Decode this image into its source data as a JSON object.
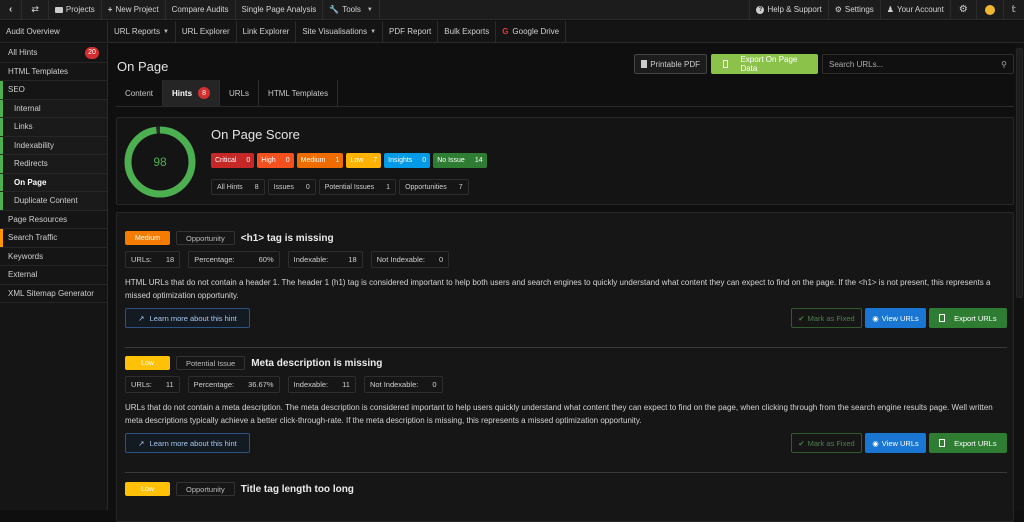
{
  "topbar": {
    "left": [
      {
        "icon": "back-icon",
        "label": ""
      },
      {
        "icon": "swap-icon",
        "label": ""
      },
      {
        "icon": "folder-icon",
        "label": "Projects"
      },
      {
        "icon": "plus-icon",
        "label": "New Project"
      },
      {
        "icon": "",
        "label": "Compare Audits"
      },
      {
        "icon": "",
        "label": "Single Page Analysis"
      },
      {
        "icon": "wrench-icon",
        "label": "Tools",
        "dropdown": true
      }
    ],
    "right": [
      {
        "icon": "help-icon",
        "label": "Help & Support"
      },
      {
        "icon": "settings-icon",
        "label": "Settings"
      },
      {
        "icon": "users-icon",
        "label": "Your Account"
      },
      {
        "icon": "gear-icon",
        "label": ""
      },
      {
        "icon": "emoji-icon",
        "label": ""
      },
      {
        "icon": "twitter-icon",
        "label": ""
      }
    ]
  },
  "subbar": {
    "overview": "Audit Overview",
    "items": [
      {
        "label": "URL Reports",
        "dropdown": true
      },
      {
        "label": "URL Explorer"
      },
      {
        "label": "Link Explorer"
      },
      {
        "label": "Site Visualisations",
        "dropdown": true
      },
      {
        "label": "PDF Report"
      },
      {
        "label": "Bulk Exports"
      },
      {
        "label": "Google Drive",
        "icon": "G"
      }
    ]
  },
  "sidebar": {
    "items": [
      {
        "label": "All Hints",
        "badge": "20"
      },
      {
        "label": "HTML Templates"
      },
      {
        "label": "SEO"
      },
      {
        "label": "Internal"
      },
      {
        "label": "Links"
      },
      {
        "label": "Indexability"
      },
      {
        "label": "Redirects"
      },
      {
        "label": "On Page"
      },
      {
        "label": "Duplicate Content"
      },
      {
        "label": "Page Resources"
      },
      {
        "label": "Search Traffic"
      },
      {
        "label": "Keywords"
      },
      {
        "label": "External"
      },
      {
        "label": "XML Sitemap Generator"
      }
    ]
  },
  "page": {
    "title": "On Page",
    "printable_pdf": "Printable PDF",
    "export": "Export On Page Data",
    "search_placeholder": "Search URLs...",
    "search_value": ""
  },
  "tabs": [
    {
      "label": "Content"
    },
    {
      "label": "Hints",
      "badge": "8"
    },
    {
      "label": "URLs"
    },
    {
      "label": "HTML Templates"
    }
  ],
  "score": {
    "title": "On Page Score",
    "value": "98",
    "percent": 98,
    "color": "#4caf50",
    "severities": [
      {
        "label": "Critical",
        "count": "0",
        "color": "#c62828"
      },
      {
        "label": "High",
        "count": "0",
        "color": "#f4511e"
      },
      {
        "label": "Medium",
        "count": "1",
        "color": "#ef6c00"
      },
      {
        "label": "Low",
        "count": "7",
        "color": "#ffb300"
      },
      {
        "label": "Insights",
        "count": "0",
        "color": "#039be5"
      },
      {
        "label": "No Issue",
        "count": "14",
        "color": "#2e7d32"
      }
    ],
    "summary": [
      {
        "label": "All Hints",
        "count": "8"
      },
      {
        "label": "Issues",
        "count": "0"
      },
      {
        "label": "Potential Issues",
        "count": "1"
      },
      {
        "label": "Opportunities",
        "count": "7"
      }
    ]
  },
  "hints": [
    {
      "level": "Medium",
      "kind": "Opportunity",
      "title": "<h1> tag is missing",
      "stats": [
        {
          "label": "URLs:",
          "value": "18"
        },
        {
          "label": "Percentage:",
          "value": "60%"
        },
        {
          "label": "Indexable:",
          "value": "18"
        },
        {
          "label": "Not Indexable:",
          "value": "0"
        }
      ],
      "description": "HTML URLs that do not contain a header 1. The header 1 (h1) tag is considered important to help both users and search engines to quickly understand what content they can expect to find on the page. If the <h1> is not present, this represents a missed optimization opportunity.",
      "learn": "Learn more about this hint",
      "mark_fixed": "Mark as Fixed",
      "view": "View URLs",
      "export": "Export URLs"
    },
    {
      "level": "Low",
      "kind": "Potential Issue",
      "title": "Meta description is missing",
      "stats": [
        {
          "label": "URLs:",
          "value": "11"
        },
        {
          "label": "Percentage:",
          "value": "36.67%"
        },
        {
          "label": "Indexable:",
          "value": "11"
        },
        {
          "label": "Not Indexable:",
          "value": "0"
        }
      ],
      "description": "URLs that do not contain a meta description. The meta description is considered important to help users quickly understand what content they can expect to find on the page, when clicking through from the search engine results page. Well written meta descriptions typically achieve a better click-through-rate. If the meta description is missing, this represents a missed optimization opportunity.",
      "learn": "Learn more about this hint",
      "mark_fixed": "Mark as Fixed",
      "view": "View URLs",
      "export": "Export URLs"
    },
    {
      "level": "Low",
      "kind": "Opportunity",
      "title": "Title tag length too long"
    }
  ]
}
